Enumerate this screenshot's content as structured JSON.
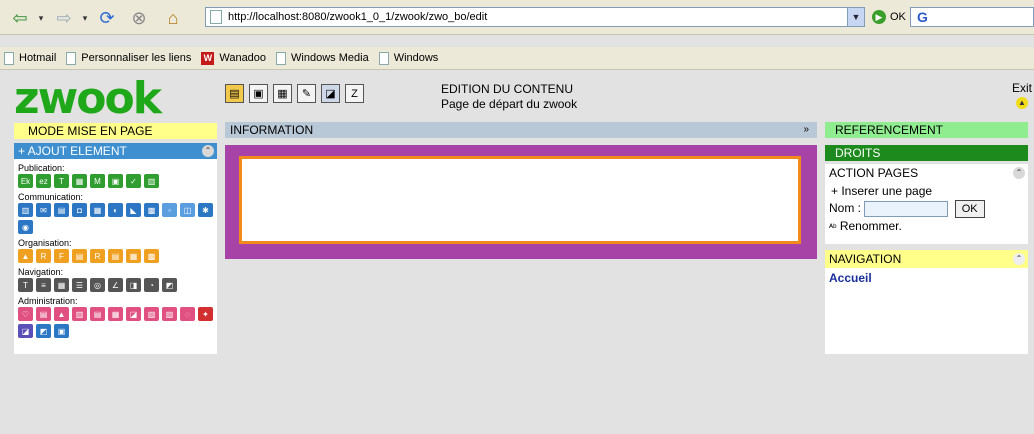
{
  "browser": {
    "url": "http://localhost:8080/zwook1_0_1/zwook/zwo_bo/edit",
    "go_label": "OK",
    "search_logo": "G"
  },
  "bookmarks": [
    {
      "label": "Hotmail",
      "icon": "page-icon"
    },
    {
      "label": "Personnaliser les liens",
      "icon": "page-icon"
    },
    {
      "label": "Wanadoo",
      "icon": "wanadoo-icon"
    },
    {
      "label": "Windows Media",
      "icon": "page-icon"
    },
    {
      "label": "Windows",
      "icon": "page-icon"
    }
  ],
  "app": {
    "logo": "zwook",
    "edition_title": "EDITION DU CONTENU",
    "edition_subtitle": "Page de départ du zwook",
    "exit_label": "Exit"
  },
  "left": {
    "mode_label": "MODE MISE EN PAGE",
    "ajout_label": "+ AJOUT ELEMENT",
    "sections": [
      {
        "label": "Publication:",
        "icons": [
          "text",
          "ez",
          "table",
          "image",
          "mp3",
          "gallery",
          "draw",
          "chart"
        ]
      },
      {
        "label": "Communication:",
        "icons": [
          "forum",
          "mail",
          "news",
          "chat",
          "link",
          "poll",
          "rss",
          "agenda",
          "faq",
          "contact",
          "event",
          "help"
        ]
      },
      {
        "label": "Organisation:",
        "icons": [
          "folder",
          "list",
          "form",
          "calendar",
          "doc",
          "tree",
          "tasks",
          "archive"
        ]
      },
      {
        "label": "Navigation:",
        "icons": [
          "menu",
          "bar",
          "grid",
          "tabs",
          "sitemap",
          "path",
          "index",
          "search",
          "back"
        ]
      },
      {
        "label": "Administration:",
        "icons": [
          "users",
          "groups",
          "rights",
          "stats",
          "logs",
          "backup",
          "config",
          "themes",
          "lang",
          "skin",
          "tools",
          "import",
          "export",
          "plugin"
        ]
      }
    ]
  },
  "center": {
    "info_label": "INFORMATION"
  },
  "right": {
    "referencement_label": "REFERENCEMENT",
    "droits_label": "DROITS",
    "action_pages_label": "ACTION PAGES",
    "inserer_label": "+ Inserer une page",
    "nom_label": "Nom :",
    "ok_label": "OK",
    "renommer_label": "Renommer.",
    "navigation_label": "NAVIGATION",
    "accueil_label": "Accueil"
  }
}
